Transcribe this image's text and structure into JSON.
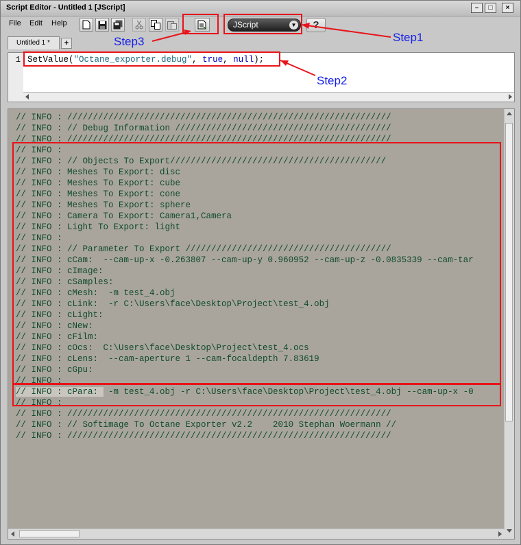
{
  "window": {
    "title": "Script Editor - Untitled 1  [JScript]"
  },
  "menu": [
    "File",
    "Edit",
    "Help"
  ],
  "toolbar": {
    "language": "JScript",
    "help_label": "?"
  },
  "tabs": [
    {
      "label": "Untitled 1 *"
    }
  ],
  "tab_add_label": "+",
  "editor": {
    "line_number": "1",
    "code_prefix": "SetValue(",
    "code_string": "\"Octane_exporter.debug\"",
    "code_sep1": ", ",
    "code_kw1": "true",
    "code_sep2": ", ",
    "code_kw2": "null",
    "code_suffix": ");"
  },
  "output_lines": [
    "// INFO : ///////////////////////////////////////////////////////////////",
    "// INFO : // Debug Information //////////////////////////////////////////",
    "// INFO : ///////////////////////////////////////////////////////////////",
    "// INFO :",
    "// INFO : // Objects To Export//////////////////////////////////////////",
    "// INFO : Meshes To Export: disc",
    "// INFO : Meshes To Export: cube",
    "// INFO : Meshes To Export: cone",
    "// INFO : Meshes To Export: sphere",
    "// INFO : Camera To Export: Camera1,Camera",
    "// INFO : Light To Export: light",
    "// INFO :",
    "// INFO : // Parameter To Export ////////////////////////////////////////",
    "// INFO : cCam:  --cam-up-x -0.263807 --cam-up-y 0.960952 --cam-up-z -0.0835339 --cam-tar",
    "// INFO : cImage:",
    "// INFO : cSamples:",
    "// INFO : cMesh:  -m test_4.obj",
    "// INFO : cLink:  -r C:\\Users\\face\\Desktop\\Project\\test_4.obj",
    "// INFO : cLight:",
    "// INFO : cNew:",
    "// INFO : cFilm:",
    "// INFO : cOcs:  C:\\Users\\face\\Desktop\\Project\\test_4.ocs",
    "// INFO : cLens:  --cam-aperture 1 --cam-focaldepth 7.83619",
    "// INFO : cGpu:",
    "// INFO :",
    "// INFO : cPara:  -m test_4.obj -r C:\\Users\\face\\Desktop\\Project\\test_4.obj --cam-up-x -0",
    "// INFO :",
    "// INFO : ///////////////////////////////////////////////////////////////",
    "// INFO : // Softimage To Octane Exporter v2.2    2010 Stephan Woermann //",
    "// INFO : ///////////////////////////////////////////////////////////////"
  ],
  "annotations": {
    "step1": "Step1",
    "step2": "Step2",
    "step3": "Step3"
  },
  "colors": {
    "annotation_red": "#e8141a",
    "annotation_blue": "#1720e8",
    "output_bg": "#a9a59d",
    "output_text": "#0f4a2a"
  }
}
